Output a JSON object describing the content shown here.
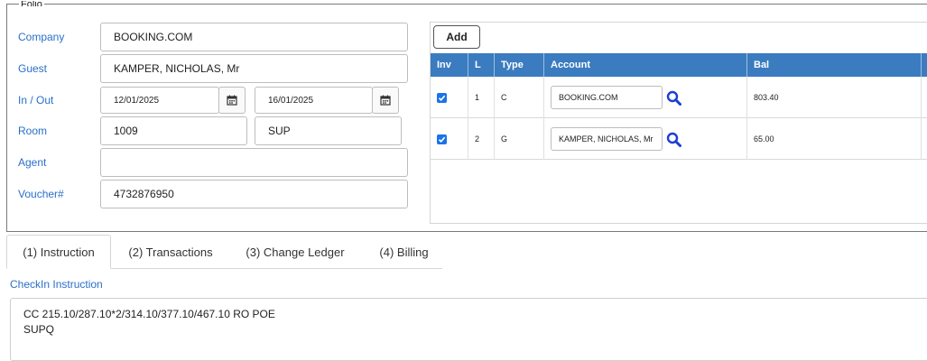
{
  "folio": {
    "legend": "Folio",
    "labels": {
      "company": "Company",
      "guest": "Guest",
      "in_out": "In / Out",
      "room": "Room",
      "agent": "Agent",
      "voucher": "Voucher#"
    },
    "values": {
      "company": "BOOKING.COM",
      "guest": "KAMPER, NICHOLAS, Mr",
      "check_in": "12/01/2025",
      "check_out": "16/01/2025",
      "room": "1009",
      "room_type": "SUP",
      "agent": "",
      "voucher": "4732876950"
    }
  },
  "ledger": {
    "add_label": "Add",
    "columns": [
      "Inv",
      "L",
      "Type",
      "Account",
      "Bal"
    ],
    "rows": [
      {
        "inv": true,
        "l": "1",
        "type": "C",
        "account": "BOOKING.COM",
        "bal": "803.40"
      },
      {
        "inv": true,
        "l": "2",
        "type": "G",
        "account": "KAMPER, NICHOLAS, Mr",
        "bal": "65.00"
      }
    ]
  },
  "tabs": [
    {
      "label": "(1) Instruction",
      "active": true
    },
    {
      "label": "(2) Transactions",
      "active": false
    },
    {
      "label": "(3) Change Ledger",
      "active": false
    },
    {
      "label": "(4) Billing",
      "active": false
    }
  ],
  "instruction": {
    "title": "CheckIn Instruction",
    "lines": [
      "CC 215.10/287.10*2/314.10/377.10/467.10 RO POE",
      "SUPQ"
    ]
  },
  "icons": {
    "calendar": "calendar-icon",
    "search": "search-icon",
    "checkbox": "checkbox-checked-icon"
  },
  "colors": {
    "label_blue": "#2a6fc9",
    "grid_header": "#3b7bbf",
    "checkbox": "#1a73e8",
    "search_icon": "#1c3fd1"
  }
}
